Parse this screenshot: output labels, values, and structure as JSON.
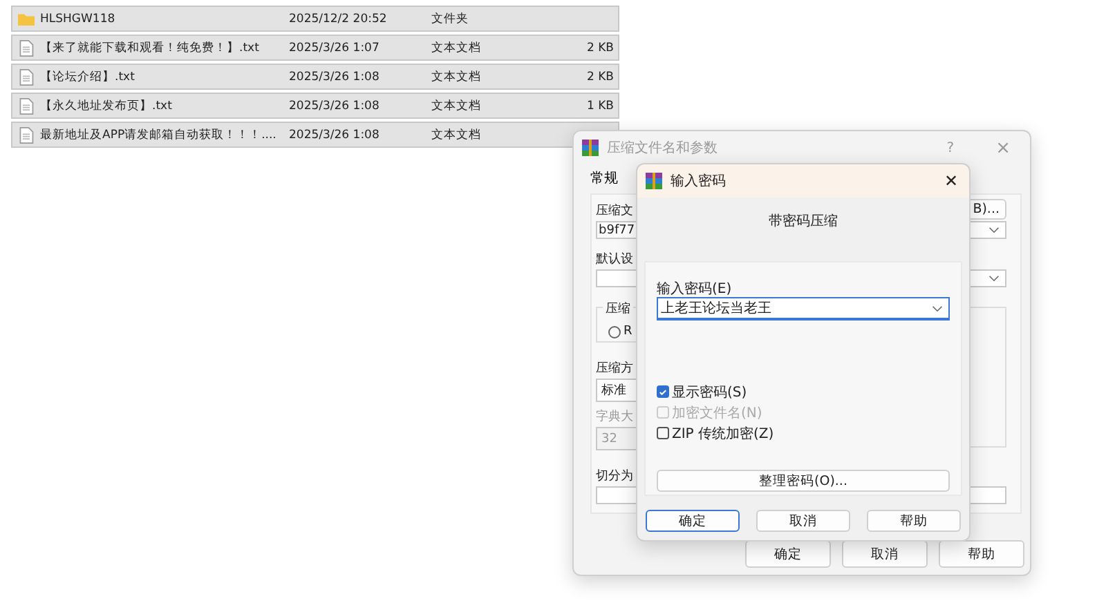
{
  "file_list": {
    "rows": [
      {
        "kind": "folder",
        "name": "HLSHGW118",
        "modified": "2025/12/2 20:52",
        "type": "文件夹"
      },
      {
        "kind": "file",
        "name": "【来了就能下载和观看！纯免费！】.txt",
        "modified": "2025/3/26 1:07",
        "type": "文本文档",
        "size": "2 KB"
      },
      {
        "kind": "file",
        "name": "【论坛介绍】.txt",
        "modified": "2025/3/26 1:08",
        "type": "文本文档",
        "size": "2 KB"
      },
      {
        "kind": "file",
        "name": "【永久地址发布页】.txt",
        "modified": "2025/3/26 1:08",
        "type": "文本文档",
        "size": "1 KB"
      },
      {
        "kind": "file",
        "name": "最新地址及APP请发邮箱自动获取！！！....",
        "modified": "2025/3/26 1:08",
        "type": "文本文档"
      }
    ]
  },
  "archive_dialog": {
    "title": "压缩文件名和参数",
    "help": "?",
    "close": "×",
    "tabs": [
      {
        "label": "常规",
        "selected": true
      }
    ],
    "archive_name_label": "压缩文",
    "browse_button": "B)...",
    "archive_name_value": "b9f77",
    "profile_label": "默认设",
    "format_group_label": "压缩",
    "format_radio": {
      "label": "R",
      "selected": false
    },
    "method_label": "压缩方",
    "method_value": "标准",
    "dict_label": "字典大",
    "dict_value": "32",
    "split_label": "切分为",
    "buttons": [
      {
        "label": "确定"
      },
      {
        "label": "取消"
      },
      {
        "label": "帮助"
      }
    ]
  },
  "password_dialog": {
    "title": "输入密码",
    "close": "✕",
    "heading": "带密码压缩",
    "password_label": "输入密码(E)",
    "password_value": "上老王论坛当老王",
    "options": [
      {
        "label": "显示密码(S)",
        "checked": true,
        "disabled": false
      },
      {
        "label": "加密文件名(N)",
        "checked": false,
        "disabled": true
      },
      {
        "label": "ZIP 传统加密(Z)",
        "checked": false,
        "disabled": false
      }
    ],
    "organize_button": "整理密码(O)...",
    "buttons": [
      {
        "label": "确定",
        "default": true
      },
      {
        "label": "取消",
        "default": false
      },
      {
        "label": "帮助",
        "default": false
      }
    ]
  }
}
